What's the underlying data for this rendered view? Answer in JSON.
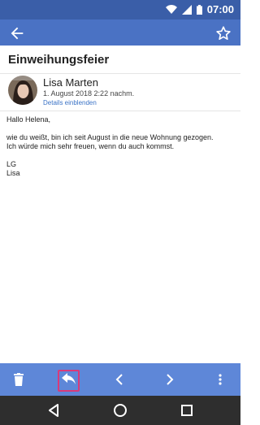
{
  "status": {
    "time": "07:00",
    "background": "#3A5EA8"
  },
  "appbar": {
    "background": "#4A72C4",
    "back_icon": "arrow-back-icon",
    "star_icon": "star-outline-icon"
  },
  "email": {
    "subject": "Einweihungsfeier",
    "sender_name": "Lisa Marten",
    "date": "1. August 2018 2:22 nachm.",
    "details_link": "Details einblenden",
    "body": {
      "greeting": "Hallo Helena,",
      "line1": "wie du weißt, bin ich seit August in die neue Wohnung gezogen.",
      "line2": "Ich würde mich sehr freuen, wenn du auch kommst.",
      "signoff1": "LG",
      "signoff2": "Lisa"
    }
  },
  "bottombar": {
    "background": "#5E87D8",
    "items": [
      "delete-icon",
      "reply-icon",
      "chevron-left-icon",
      "chevron-right-icon",
      "more-vert-icon"
    ],
    "highlight_color": "#d93a7a"
  },
  "navbar": {
    "items": [
      "back-triangle-icon",
      "home-circle-icon",
      "overview-square-icon"
    ]
  }
}
